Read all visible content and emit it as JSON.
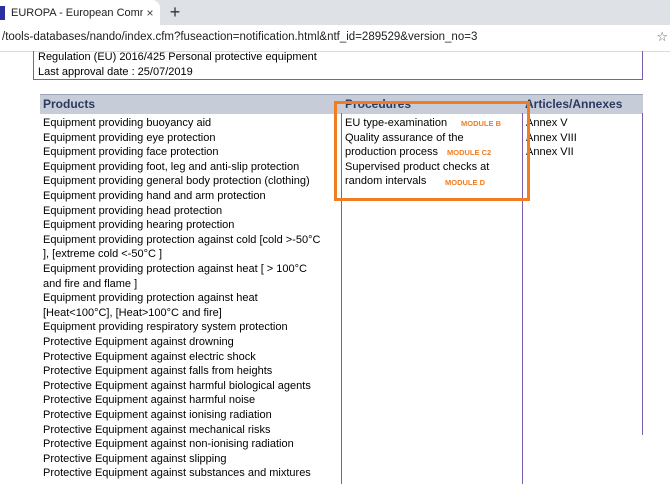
{
  "browser": {
    "tab_title": "EUROPA - European Commission",
    "tab_close": "×",
    "new_tab": "+",
    "url": "/tools-databases/nando/index.cfm?fuseaction=notification.html&ntf_id=289529&version_no=3",
    "bookmark_icon": "star-icon"
  },
  "header": {
    "regulation": "Regulation (EU) 2016/425 Personal protective equipment",
    "approval": "Last approval date : 25/07/2019"
  },
  "table": {
    "columns": [
      "Products",
      "Procedures",
      "Articles/Annexes"
    ],
    "products": [
      "Equipment providing buoyancy aid",
      "Equipment providing eye protection",
      "Equipment providing face protection",
      "Equipment providing foot, leg and anti-slip protection",
      "Equipment providing general body protection (clothing)",
      "Equipment providing hand and arm protection",
      "Equipment providing head protection",
      "Equipment providing hearing protection",
      "Equipment providing protection against cold [cold >-50°C",
      "], [extreme cold <-50°C ]",
      "Equipment providing protection against heat [ > 100°C",
      "and fire and flame ]",
      "Equipment providing protection against heat",
      "[Heat<100°C], [Heat>100°C and fire]",
      "Equipment providing respiratory system protection",
      "Protective Equipment against drowning",
      "Protective Equipment against electric shock",
      "Protective Equipment against falls from heights",
      "Protective Equipment against harmful biological agents",
      "Protective Equipment against harmful noise",
      "Protective Equipment against ionising radiation",
      "Protective Equipment against mechanical risks",
      "Protective Equipment against non-ionising radiation",
      "Protective Equipment against slipping",
      "Protective Equipment against substances and mixtures"
    ],
    "procedures": [
      "EU type-examination",
      "Quality assurance of the",
      "production process",
      "Supervised product checks at",
      "random intervals"
    ],
    "modules": [
      "MODULE B",
      "MODULE C2",
      "MODULE D"
    ],
    "annexes": [
      "Annex V",
      "Annex VIII",
      "Annex VII"
    ]
  },
  "colors": {
    "highlight": "#f07d22",
    "header_bg": "#c7ccd9",
    "border": "#7b5ea7"
  }
}
